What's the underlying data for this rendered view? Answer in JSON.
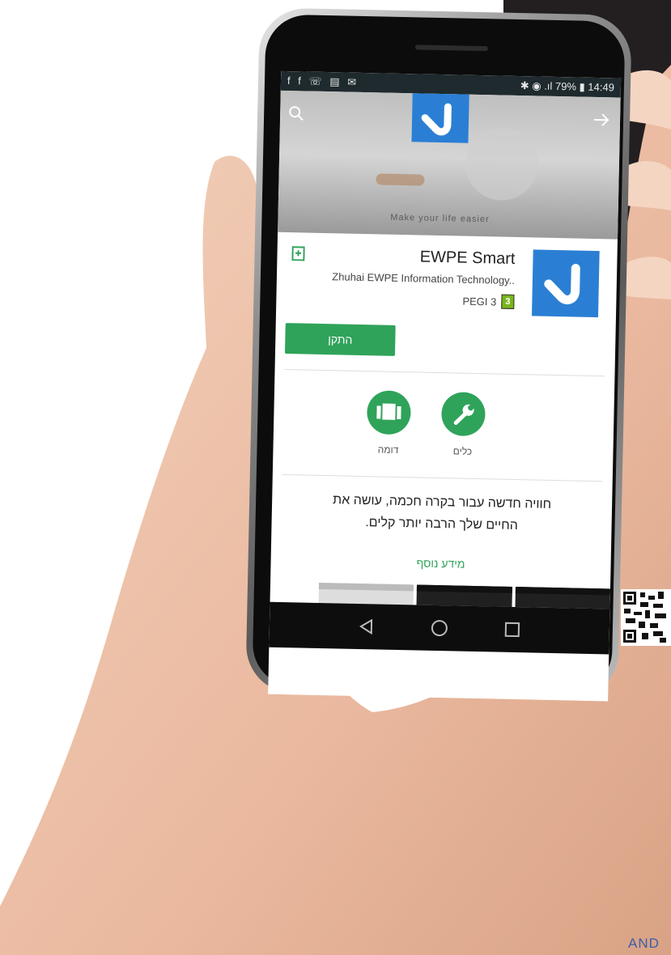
{
  "status_bar": {
    "left_icons": "f f ☏ ▤ ✉",
    "right_text": "✱ ◉ .ıl 79% ▮ 14:49",
    "battery_percent": "79%",
    "time": "14:49"
  },
  "banner": {
    "tagline": "Make your life easier",
    "icons": [
      "search-icon",
      "arrow-right-icon"
    ]
  },
  "app": {
    "title": "EWPE Smart",
    "developer": "Zhuhai EWPE Information Technology..",
    "rating_label": "PEGI 3",
    "rating_badge": "3",
    "install_label": "התקן"
  },
  "categories": [
    {
      "label": "כלים",
      "icon": "wrench-icon"
    },
    {
      "label": "דומה",
      "icon": "cards-icon"
    }
  ],
  "description": {
    "line1": "חוויה חדשה עבור בקרה חכמה, עושה את",
    "line2": "החיים שלך הרבה יותר קלים."
  },
  "more_info_label": "מידע נוסף",
  "bottom_text": "AND",
  "colors": {
    "accent_green": "#2fa35a",
    "brand_blue": "#2a7fd4",
    "dark_panel": "#231f20"
  }
}
